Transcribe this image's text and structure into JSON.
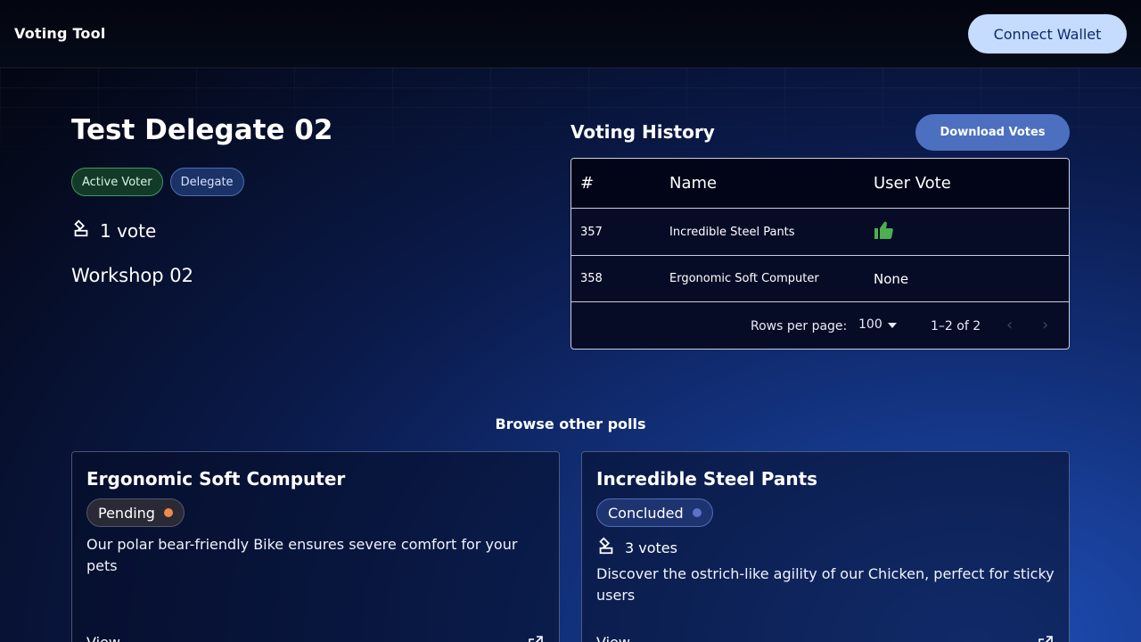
{
  "header": {
    "app_title": "Voting Tool",
    "connect_label": "Connect Wallet"
  },
  "delegate": {
    "name": "Test Delegate 02",
    "tags": [
      "Active Voter",
      "Delegate"
    ],
    "votes": "1 vote",
    "workshop": "Workshop 02"
  },
  "history": {
    "title": "Voting History",
    "download_label": "Download Votes",
    "columns": [
      "#",
      "Name",
      "User Vote"
    ],
    "rows": [
      {
        "id": "357",
        "name": "Incredible Steel Pants",
        "vote": "thumbs-up-icon"
      },
      {
        "id": "358",
        "name": "Ergonomic Soft Computer",
        "vote": "None"
      }
    ],
    "rows_per_page_label": "Rows per page:",
    "rows_per_page": "100",
    "range": "1–2 of 2"
  },
  "browse": {
    "title": "Browse other polls",
    "polls": [
      {
        "title": "Ergonomic Soft Computer",
        "status": "Pending",
        "status_color": "#f08a4b",
        "description": "Our polar bear-friendly Bike ensures severe comfort for your pets",
        "view_label": "View"
      },
      {
        "title": "Incredible Steel Pants",
        "status": "Concluded",
        "status_color": "#5a72c9",
        "votes": "3 votes",
        "description": "Discover the ostrich-like agility of our Chicken, perfect for sticky users",
        "view_label": "View"
      }
    ]
  },
  "colors": {
    "accent": "#c5dcff",
    "thumbs_up": "#4caf50"
  }
}
